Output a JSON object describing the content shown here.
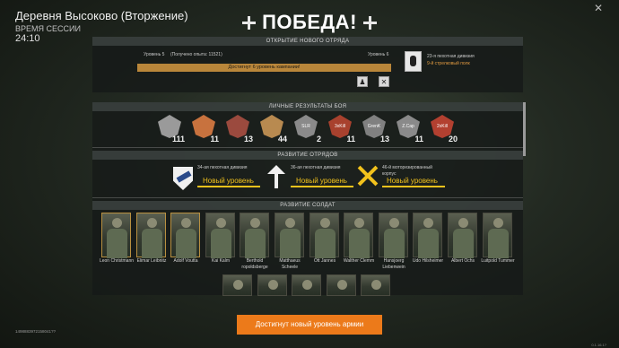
{
  "header": {
    "title": "Деревня Высоково (Вторжение)",
    "session_label": "ВРЕМЯ СЕССИИ",
    "session_time": "24:10"
  },
  "victory": {
    "text": "ПОБЕДА!"
  },
  "new_squad": {
    "title": "ОТКРЫТИЕ НОВОГО ОТРЯДА",
    "level_current": "Уровень 5",
    "exp": "(Получено опыта: 11521)",
    "level_next": "Уровень 6",
    "progress_text": "Достигнут 6 уровень кампании!",
    "progress": 1.0,
    "unit_name": "23-я пехотная дивизия",
    "unit_sub": "9-й стрелковый полк"
  },
  "battle": {
    "title": "ЛИЧНЫЕ РЕЗУЛЬТАТЫ БОЯ",
    "medals": [
      {
        "label": "",
        "count": "111",
        "color": "#9a9a9a"
      },
      {
        "label": "",
        "count": "11",
        "color": "#c8723e"
      },
      {
        "label": "",
        "count": "13",
        "color": "#9b4a3e"
      },
      {
        "label": "",
        "count": "44",
        "color": "#b88a50"
      },
      {
        "label": "SLR",
        "count": "2",
        "color": "#8a8a8a"
      },
      {
        "label": "3xKill",
        "count": "11",
        "color": "#a8412e"
      },
      {
        "label": "GrenK",
        "count": "13",
        "color": "#808080"
      },
      {
        "label": "Z.Cap",
        "count": "11",
        "color": "#8a8a8a"
      },
      {
        "label": "2xKill",
        "count": "20",
        "color": "#b34030"
      }
    ]
  },
  "squads": {
    "title": "РАЗВИТИЕ ОТРЯДОВ",
    "items": [
      {
        "name": "34-ая пехотная дивизия",
        "status": "Новый уровень"
      },
      {
        "name": "36-ая пехотная дивизия",
        "status": "Новый уровень"
      },
      {
        "name": "46-й моторезированный корпус",
        "status": "Новый уровень"
      }
    ]
  },
  "soldiers": {
    "title": "РАЗВИТИЕ СОЛДАТ",
    "row1": [
      {
        "name": "Leon Christmann"
      },
      {
        "name": "Elimar Leibnitz"
      },
      {
        "name": "Adolf Voutta"
      },
      {
        "name": "Kai Kalm"
      },
      {
        "name": "Berthold ropoldsberge"
      },
      {
        "name": "Matthaeus Scheele"
      },
      {
        "name": "Ott Jannes"
      },
      {
        "name": "Walther Clemm"
      },
      {
        "name": "Hansjoerg Liebenwein"
      },
      {
        "name": "Udo Hilsheimer"
      },
      {
        "name": "Albert Ochs"
      },
      {
        "name": "Luitpold Tummer"
      }
    ],
    "row2_count": 5
  },
  "footer": {
    "button": "Достигнут новый уровень армии",
    "session_id": "1498883972158041??",
    "version": "0.1.16.1?"
  },
  "colors": {
    "accent": "#ec7a1a",
    "gold": "#f2c21c"
  }
}
